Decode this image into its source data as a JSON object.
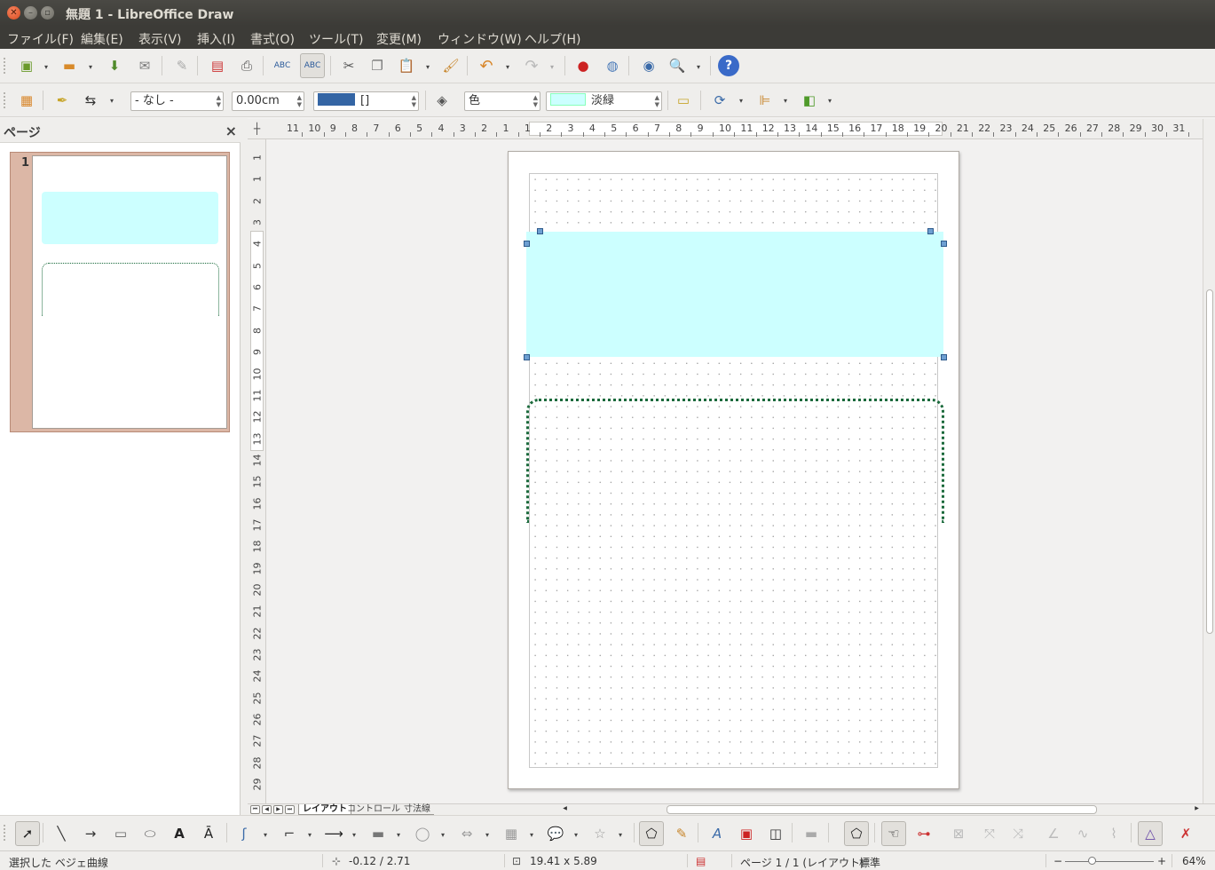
{
  "window": {
    "title": "無題 1 - LibreOffice Draw"
  },
  "menu": [
    "ファイル(F)",
    "編集(E)",
    "表示(V)",
    "挿入(I)",
    "書式(O)",
    "ツール(T)",
    "変更(M)",
    "ウィンドウ(W)",
    "ヘルプ(H)"
  ],
  "line_toolbar": {
    "arrow_style": "- なし -",
    "line_width": "0.00cm",
    "line_color_name": "[]",
    "line_color": "#3465a4",
    "area_style": "色",
    "area_color_name": "淡緑",
    "area_color": "#ccffff"
  },
  "pages_panel": {
    "title": "ページ",
    "close_glyph": "×",
    "page_number": "1"
  },
  "ruler": {
    "corner_glyph": "┼",
    "h_labels": [
      "11",
      "10",
      "9",
      "8",
      "7",
      "6",
      "5",
      "4",
      "3",
      "2",
      "1",
      "1",
      "2",
      "3",
      "4",
      "5",
      "6",
      "7",
      "8",
      "9",
      "10",
      "11",
      "12",
      "13",
      "14",
      "15",
      "16",
      "17",
      "18",
      "19",
      "20",
      "21",
      "22",
      "23",
      "24",
      "25",
      "26",
      "27",
      "28",
      "29",
      "30",
      "31"
    ],
    "v_labels": [
      "1",
      "1",
      "2",
      "3",
      "4",
      "5",
      "6",
      "7",
      "8",
      "9",
      "10",
      "11",
      "12",
      "13",
      "14",
      "15",
      "16",
      "17",
      "18",
      "19",
      "20",
      "21",
      "22",
      "23",
      "24",
      "25",
      "26",
      "27",
      "28",
      "29"
    ]
  },
  "canvas": {
    "rect_fill": "#ccffff",
    "curve_color": "#1b6a3c",
    "handle_color": "#6d9fd1"
  },
  "tabs": [
    "レイアウト",
    "コントロール",
    "寸法線"
  ],
  "status": {
    "selection": "選択した ベジェ曲線",
    "position": "-0.12 / 2.71",
    "size": "19.41 x 5.89",
    "page": "ページ 1 / 1 (レイアウト)",
    "style": "標準",
    "zoom_minus": "−",
    "zoom_plus": "+",
    "zoom": "64%"
  }
}
